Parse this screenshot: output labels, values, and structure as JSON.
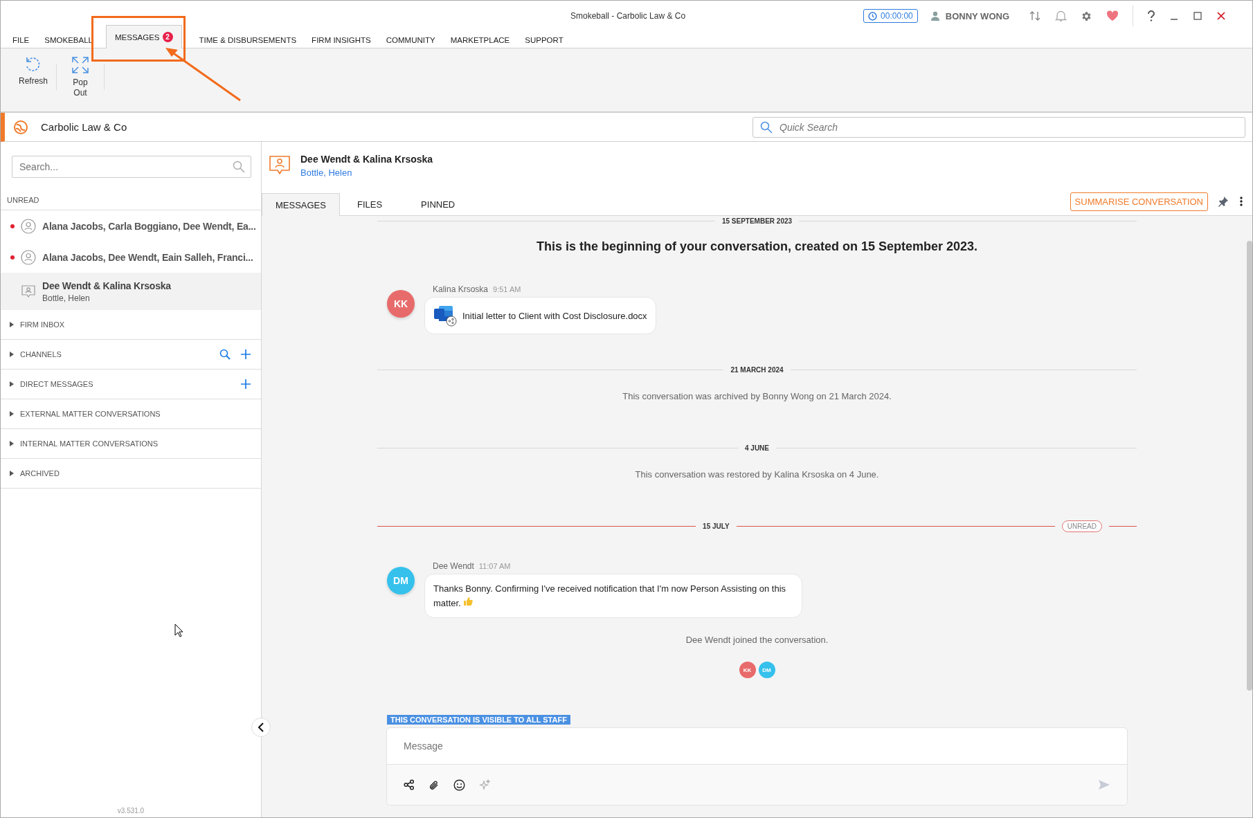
{
  "window": {
    "title": "Smokeball - Carbolic Law & Co",
    "timer": "00:00:00",
    "user": "BONNY WONG"
  },
  "menu_tabs": [
    {
      "label": "FILE",
      "selected": false
    },
    {
      "label": "SMOKEBALL",
      "selected": false
    },
    {
      "label": "MESSAGES",
      "selected": true,
      "badge": "2"
    },
    {
      "label": "TIME & DISBURSEMENTS",
      "selected": false
    },
    {
      "label": "FIRM INSIGHTS",
      "selected": false
    },
    {
      "label": "COMMUNITY",
      "selected": false
    },
    {
      "label": "MARKETPLACE",
      "selected": false
    },
    {
      "label": "SUPPORT",
      "selected": false
    }
  ],
  "ribbon": [
    {
      "kind": "refresh",
      "label": "Refresh"
    },
    {
      "kind": "popout",
      "label": "Pop Out"
    }
  ],
  "org": {
    "name": "Carbolic Law & Co",
    "search_placeholder": "Quick Search"
  },
  "sidebar": {
    "search_placeholder": "Search...",
    "unread_label": "UNREAD",
    "conversations": [
      {
        "kind": "group",
        "title": "Alana Jacobs, Carla Boggiano, Dee Wendt, Ea...",
        "unread": true,
        "selected": false
      },
      {
        "kind": "group",
        "title": "Alana Jacobs, Dee Wendt, Eain Salleh, Franci...",
        "unread": true,
        "selected": false
      },
      {
        "kind": "matter",
        "title": "Dee Wendt & Kalina Krsoska",
        "subtitle": "Bottle, Helen",
        "unread": false,
        "selected": true
      }
    ],
    "sections": [
      {
        "label": "FIRM INBOX",
        "expanded": false
      },
      {
        "label": "CHANNELS",
        "expanded": false,
        "search_button": true,
        "add_button": true
      },
      {
        "label": "DIRECT MESSAGES",
        "expanded": false,
        "add_button": true
      },
      {
        "label": "EXTERNAL MATTER CONVERSATIONS",
        "expanded": false
      },
      {
        "label": "INTERNAL MATTER CONVERSATIONS",
        "expanded": false
      },
      {
        "label": "ARCHIVED",
        "expanded": false
      }
    ],
    "version": "v3.531.0"
  },
  "conversation": {
    "title": "Dee Wendt & Kalina Krsoska",
    "subtitle": "Bottle, Helen",
    "tabs": [
      {
        "label": "MESSAGES",
        "selected": true
      },
      {
        "label": "FILES",
        "selected": false
      },
      {
        "label": "PINNED",
        "selected": false
      }
    ],
    "summarise_button": "SUMMARISE CONVERSATION"
  },
  "timeline": [
    {
      "kind": "date",
      "label": "15 SEPTEMBER 2023",
      "unread": false
    },
    {
      "kind": "intro",
      "text": "This is the beginning of your conversation, created on 15 September 2023."
    },
    {
      "kind": "message",
      "initials": "KK",
      "color": "#e86b6b",
      "author": "Kalina Krsoska",
      "time": "9:51 AM",
      "attachment": "Initial letter to Client with Cost Disclosure.docx"
    },
    {
      "kind": "date",
      "label": "21 MARCH 2024",
      "unread": false
    },
    {
      "kind": "event",
      "text": "This conversation was archived by Bonny Wong on 21 March 2024."
    },
    {
      "kind": "date",
      "label": "4 JUNE",
      "unread": false
    },
    {
      "kind": "event",
      "text": "This conversation was restored by Kalina Krsoska on 4 June."
    },
    {
      "kind": "date",
      "label": "15 JULY",
      "unread": true,
      "marker": "UNREAD"
    },
    {
      "kind": "message",
      "initials": "DM",
      "color": "#35c1ec",
      "author": "Dee Wendt",
      "time": "11:07 AM",
      "text": "Thanks Bonny. Confirming I've received notification that I'm now Person Assisting on this matter.",
      "thumbs_up": true
    },
    {
      "kind": "event",
      "text": "Dee Wendt joined the conversation."
    },
    {
      "kind": "participants",
      "avatars": [
        {
          "initials": "KK",
          "color": "#e86b6b"
        },
        {
          "initials": "DM",
          "color": "#35c1ec"
        }
      ]
    }
  ],
  "composer": {
    "visibility": "THIS CONVERSATION IS VISIBLE TO ALL STAFF",
    "placeholder": "Message"
  }
}
